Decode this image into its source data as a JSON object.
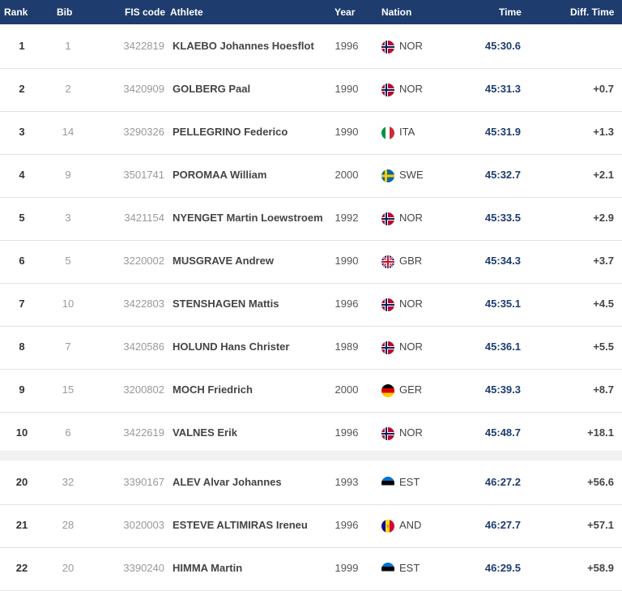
{
  "header": {
    "rank": "Rank",
    "bib": "Bib",
    "fis": "FIS code",
    "athlete": "Athlete",
    "year": "Year",
    "nation": "Nation",
    "time": "Time",
    "diff": "Diff. Time"
  },
  "rows": [
    {
      "rank": "1",
      "bib": "1",
      "fis": "3422819",
      "name": "KLAEBO Johannes Hoesflot",
      "year": "1996",
      "nation": "NOR",
      "time": "45:30.6",
      "diff": ""
    },
    {
      "rank": "2",
      "bib": "2",
      "fis": "3420909",
      "name": "GOLBERG Paal",
      "year": "1990",
      "nation": "NOR",
      "time": "45:31.3",
      "diff": "+0.7"
    },
    {
      "rank": "3",
      "bib": "14",
      "fis": "3290326",
      "name": "PELLEGRINO Federico",
      "year": "1990",
      "nation": "ITA",
      "time": "45:31.9",
      "diff": "+1.3"
    },
    {
      "rank": "4",
      "bib": "9",
      "fis": "3501741",
      "name": "POROMAA William",
      "year": "2000",
      "nation": "SWE",
      "time": "45:32.7",
      "diff": "+2.1"
    },
    {
      "rank": "5",
      "bib": "3",
      "fis": "3421154",
      "name": "NYENGET Martin Loewstroem",
      "year": "1992",
      "nation": "NOR",
      "time": "45:33.5",
      "diff": "+2.9"
    },
    {
      "rank": "6",
      "bib": "5",
      "fis": "3220002",
      "name": "MUSGRAVE Andrew",
      "year": "1990",
      "nation": "GBR",
      "time": "45:34.3",
      "diff": "+3.7"
    },
    {
      "rank": "7",
      "bib": "10",
      "fis": "3422803",
      "name": "STENSHAGEN Mattis",
      "year": "1996",
      "nation": "NOR",
      "time": "45:35.1",
      "diff": "+4.5"
    },
    {
      "rank": "8",
      "bib": "7",
      "fis": "3420586",
      "name": "HOLUND Hans Christer",
      "year": "1989",
      "nation": "NOR",
      "time": "45:36.1",
      "diff": "+5.5"
    },
    {
      "rank": "9",
      "bib": "15",
      "fis": "3200802",
      "name": "MOCH Friedrich",
      "year": "2000",
      "nation": "GER",
      "time": "45:39.3",
      "diff": "+8.7"
    },
    {
      "rank": "10",
      "bib": "6",
      "fis": "3422619",
      "name": "VALNES Erik",
      "year": "1996",
      "nation": "NOR",
      "time": "45:48.7",
      "diff": "+18.1"
    },
    {
      "rank": "20",
      "bib": "32",
      "fis": "3390167",
      "name": "ALEV Alvar Johannes",
      "year": "1993",
      "nation": "EST",
      "time": "46:27.2",
      "diff": "+56.6"
    },
    {
      "rank": "21",
      "bib": "28",
      "fis": "3020003",
      "name": "ESTEVE ALTIMIRAS Ireneu",
      "year": "1996",
      "nation": "AND",
      "time": "46:27.7",
      "diff": "+57.1"
    },
    {
      "rank": "22",
      "bib": "20",
      "fis": "3390240",
      "name": "HIMMA Martin",
      "year": "1999",
      "nation": "EST",
      "time": "46:29.5",
      "diff": "+58.9"
    }
  ],
  "colors": {
    "header_bg": "#1e3c6e",
    "time_text": "#1e3c6e"
  }
}
